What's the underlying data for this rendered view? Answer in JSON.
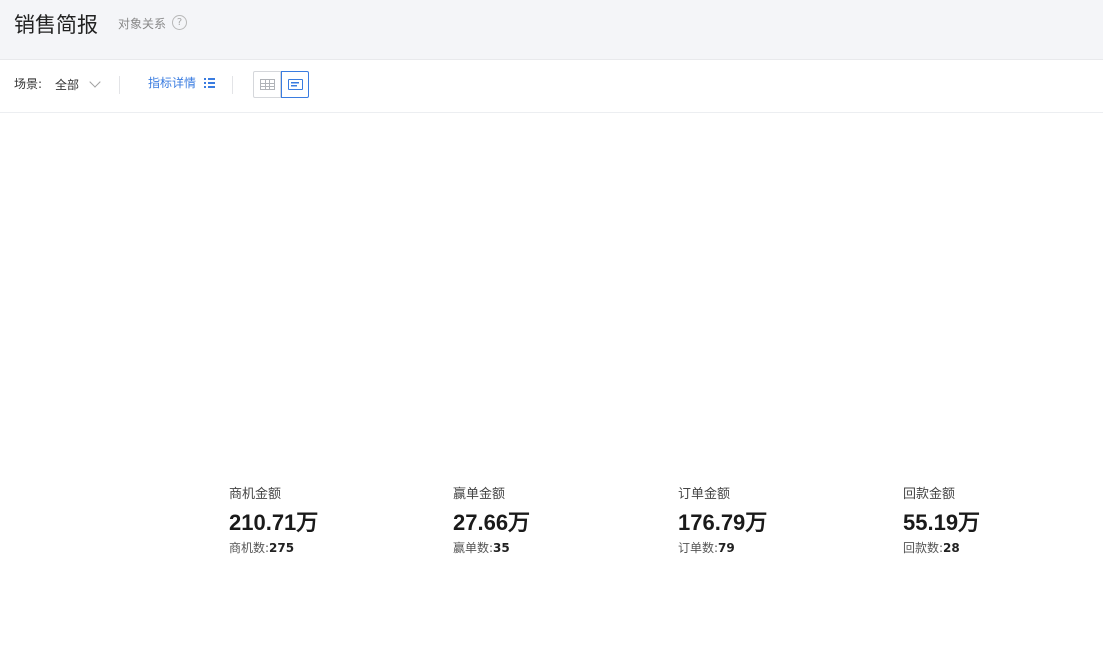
{
  "header": {
    "title": "销售简报",
    "relation_link": "对象关系",
    "help_icon": "?"
  },
  "toolbar": {
    "scene_label": "场景:",
    "scene_value": "全部",
    "metric_detail_label": "指标详情"
  },
  "stats": [
    {
      "label": "商机金额",
      "value": "210.71万",
      "count_label": "商机数:",
      "count": "275"
    },
    {
      "label": "赢单金额",
      "value": "27.66万",
      "count_label": "赢单数:",
      "count": "35"
    },
    {
      "label": "订单金额",
      "value": "176.79万",
      "count_label": "订单数:",
      "count": "79"
    },
    {
      "label": "回款金额",
      "value": "55.19万",
      "count_label": "回款数:",
      "count": "28"
    }
  ],
  "colors": {
    "accent": "#3a7ce0",
    "header_bg": "#f4f5f8"
  }
}
